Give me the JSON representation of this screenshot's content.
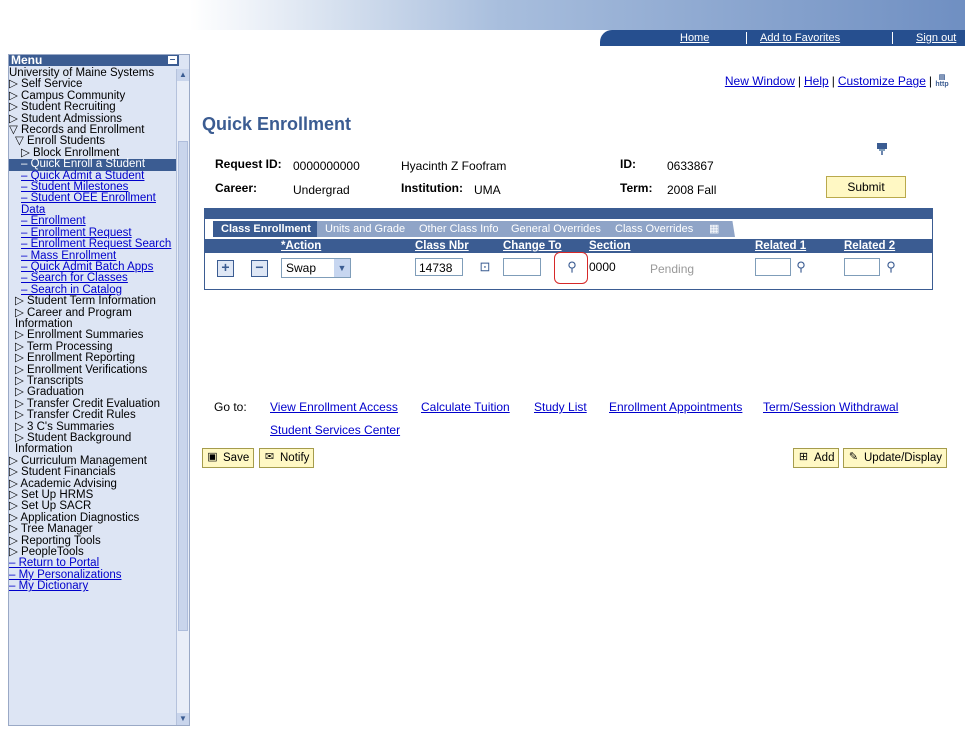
{
  "banner": {
    "home": "Home",
    "favorites": "Add to Favorites",
    "signout": "Sign out"
  },
  "menu": {
    "title": "Menu",
    "items": [
      {
        "label": "University of Maine Systems",
        "cls": ""
      },
      {
        "label": "▷ Self Service",
        "cls": ""
      },
      {
        "label": "▷ Campus Community",
        "cls": ""
      },
      {
        "label": "▷ Student Recruiting",
        "cls": ""
      },
      {
        "label": "▷ Student Admissions",
        "cls": ""
      },
      {
        "label": "▽ Records and Enrollment",
        "cls": ""
      },
      {
        "label": "▽ Enroll Students",
        "cls": "i1"
      },
      {
        "label": "▷ Block Enrollment",
        "cls": "i2"
      },
      {
        "label": "– Quick Enroll a Student",
        "cls": "i2 sel"
      },
      {
        "label": "– Quick Admit a Student",
        "cls": "i2 lnk"
      },
      {
        "label": "– Student Milestones",
        "cls": "i2 lnk"
      },
      {
        "label": "– Student OEE Enrollment Data",
        "cls": "i2 lnk"
      },
      {
        "label": "– Enrollment",
        "cls": "i2 lnk"
      },
      {
        "label": "– Enrollment Request",
        "cls": "i2 lnk"
      },
      {
        "label": "– Enrollment Request Search",
        "cls": "i2 lnk"
      },
      {
        "label": "– Mass Enrollment",
        "cls": "i2 lnk"
      },
      {
        "label": "– Quick Admit Batch Apps",
        "cls": "i2 lnk"
      },
      {
        "label": "– Search for Classes",
        "cls": "i2 lnk"
      },
      {
        "label": "– Search in Catalog",
        "cls": "i2 lnk"
      },
      {
        "label": "▷ Student Term Information",
        "cls": "i1"
      },
      {
        "label": "▷ Career and Program Information",
        "cls": "i1"
      },
      {
        "label": "▷ Enrollment Summaries",
        "cls": "i1"
      },
      {
        "label": "▷ Term Processing",
        "cls": "i1"
      },
      {
        "label": "▷ Enrollment Reporting",
        "cls": "i1"
      },
      {
        "label": "▷ Enrollment Verifications",
        "cls": "i1"
      },
      {
        "label": "▷ Transcripts",
        "cls": "i1"
      },
      {
        "label": "▷ Graduation",
        "cls": "i1"
      },
      {
        "label": "▷ Transfer Credit Evaluation",
        "cls": "i1"
      },
      {
        "label": "▷ Transfer Credit Rules",
        "cls": "i1"
      },
      {
        "label": "▷ 3 C's Summaries",
        "cls": "i1"
      },
      {
        "label": "▷ Student Background Information",
        "cls": "i1"
      },
      {
        "label": "▷ Curriculum Management",
        "cls": ""
      },
      {
        "label": "▷ Student Financials",
        "cls": ""
      },
      {
        "label": "▷ Academic Advising",
        "cls": ""
      },
      {
        "label": "▷ Set Up HRMS",
        "cls": ""
      },
      {
        "label": "▷ Set Up SACR",
        "cls": ""
      },
      {
        "label": "▷ Application Diagnostics",
        "cls": ""
      },
      {
        "label": "▷ Tree Manager",
        "cls": ""
      },
      {
        "label": "▷ Reporting Tools",
        "cls": ""
      },
      {
        "label": "▷ PeopleTools",
        "cls": ""
      },
      {
        "label": "– Return to Portal",
        "cls": "lnk"
      },
      {
        "label": "– My Personalizations",
        "cls": "lnk"
      },
      {
        "label": "– My Dictionary",
        "cls": "lnk"
      }
    ]
  },
  "pagelinks": {
    "new_window": "New Window",
    "help": "Help",
    "customize": "Customize Page",
    "http": "http"
  },
  "page_title": "Quick Enrollment",
  "header": {
    "request_id_label": "Request ID:",
    "request_id": "0000000000",
    "name": "Hyacinth Z Foofram",
    "id_label": "ID:",
    "id": "0633867",
    "career_label": "Career:",
    "career": "Undergrad",
    "institution_label": "Institution:",
    "institution": "UMA",
    "term_label": "Term:",
    "term": "2008 Fall",
    "submit": "Submit"
  },
  "tabs": [
    "Class Enrollment",
    "Units and Grade",
    "Other Class Info",
    "General Overrides",
    "Class Overrides"
  ],
  "columns": {
    "action": "*Action",
    "class_nbr": "Class Nbr",
    "change_to": "Change To",
    "section": "Section",
    "related1": "Related 1",
    "related2": "Related 2"
  },
  "row": {
    "action": "Swap",
    "class_nbr": "14738",
    "change_to": "",
    "section": "0000",
    "status": "Pending",
    "related1": "",
    "related2": ""
  },
  "goto": {
    "label": "Go to:",
    "links": [
      "View Enrollment Access",
      "Calculate Tuition",
      "Study List",
      "Enrollment Appointments",
      "Term/Session Withdrawal",
      "Student Services Center"
    ]
  },
  "buttons": {
    "save": "Save",
    "notify": "Notify",
    "add": "Add",
    "update": "Update/Display"
  }
}
